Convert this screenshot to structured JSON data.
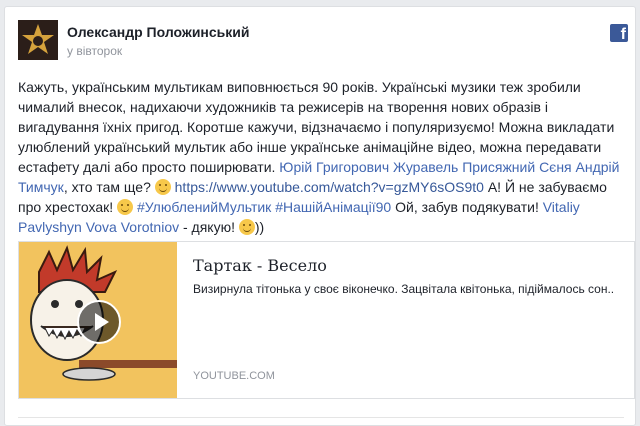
{
  "post": {
    "author": "Олександр Положинський",
    "timestamp": "у вівторок",
    "text": {
      "p1": "Кажуть, українським мультикам виповнюється 90 років. Українські музики теж зробили чималий внесок, надихаючи художників та режисерів на творення нових образів і вигадування їхніх пригод. Коротше кажучи, відзначаємо і популяризуємо! Можна викладати улюблений український мультик або інше українське анімаційне відео, можна передавати естафету далі або просто поширювати. ",
      "mention1": "Юрій Григорович Журавель",
      "mention2": "Присяжний Сєня",
      "mention3": "Андрій Тимчук",
      "p2": ", хто там ще? ",
      "url": "https://www.youtube.com/watch?v=gzMY6sOS9t0",
      "p3": " А! Й не забуваємо про хрестохак! ",
      "hashtags": "#УлюбленийМультик #НашійАнімації90",
      "p4": " Ой, забув подякувати! ",
      "mention4": "Vitaliy Pavlyshyn",
      "mention5": "Vova Vorotniov",
      "p5": " - дякую! ",
      "p6": "))"
    }
  },
  "share": {
    "title": "Тартак - Весело",
    "description": "Визирнула тітонька у своє віконечко. Зацвітала квітонька, підіймалось сон..",
    "source": "YOUTUBE.COM",
    "thumbnail_icon": "play-icon"
  },
  "icons": {
    "facebook": "facebook-icon",
    "emoji": "smile-emoji-icon"
  },
  "colors": {
    "link": "#4267b2",
    "facebook": "#3b5998",
    "muted": "#90949c"
  }
}
